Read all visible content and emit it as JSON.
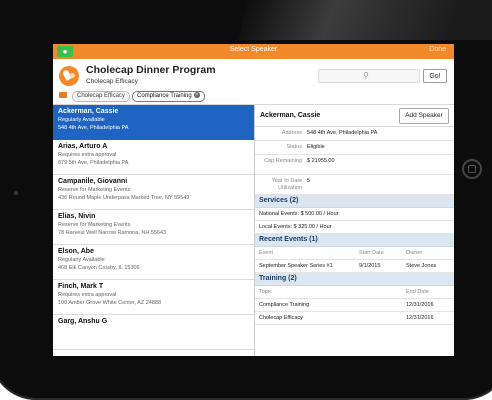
{
  "topbar": {
    "title": "Select Speaker",
    "done": "Done"
  },
  "header": {
    "program_title": "Cholecap Dinner Program",
    "program_subtitle": "Cholecap Efficacy",
    "search_placeholder": "",
    "go_label": "Go!",
    "chips": [
      "Cholecap Efficacy",
      "Compliance Training"
    ]
  },
  "speakers": [
    {
      "name": "Ackerman, Cassie",
      "status": "Regularly Available",
      "address": "548 4th Ave, Philadelphia PA"
    },
    {
      "name": "Arias, Arturo A",
      "status": "Requires extra approval",
      "address": "879 5th Ave, Philadelphia PA"
    },
    {
      "name": "Campanile, Giovanni",
      "status": "Reserve for Marketing Events",
      "address": "436 Round Maple Underpass Marked Tree, NY 59549"
    },
    {
      "name": "Elias, Nivin",
      "status": "Reserve for Marketing Events",
      "address": "78 Harvest Well Narrow Ramona, NH 55643"
    },
    {
      "name": "Elson, Abe",
      "status": "Regularly Available",
      "address": "468 Elk Canyon Crosby, IL 15306"
    },
    {
      "name": "Finch, Mark T",
      "status": "Requires extra approval",
      "address": "100 Amber Grove White Center, AZ 24888"
    },
    {
      "name": "Garg, Anshu G",
      "status": "",
      "address": ""
    }
  ],
  "detail": {
    "name": "Ackerman, Cassie",
    "add_button": "Add Speaker",
    "fields": [
      {
        "label": "Address",
        "value": "548 4th Ave, Philadelphia PA"
      },
      {
        "label": "Status",
        "value": "Eligible"
      },
      {
        "label": "Cap Remaining",
        "value": "$ 21955.00"
      },
      {
        "label": "Year to Date Utilization",
        "value": "5"
      }
    ],
    "services_title": "Services (2)",
    "services": [
      "National Events: $ 500.00 / Hour",
      "Local Events: $ 325.00 / Hour"
    ],
    "events_title": "Recent Events (1)",
    "events_header": {
      "event": "Event",
      "start": "Start Date",
      "owner": "Owner"
    },
    "events": [
      {
        "event": "September Speaker Series #1",
        "start": "9/1/2015",
        "owner": "Steve Jones"
      }
    ],
    "training_title": "Training (2)",
    "training_header": {
      "topic": "Topic",
      "end": "End Date"
    },
    "training": [
      {
        "topic": "Compliance Training",
        "end": "12/31/2016"
      },
      {
        "topic": "Cholecap Efficacy",
        "end": "12/31/2016"
      }
    ]
  },
  "colors": {
    "accent": "#f2892b",
    "selection": "#1f64c2",
    "section_bg": "#dce6f1"
  }
}
